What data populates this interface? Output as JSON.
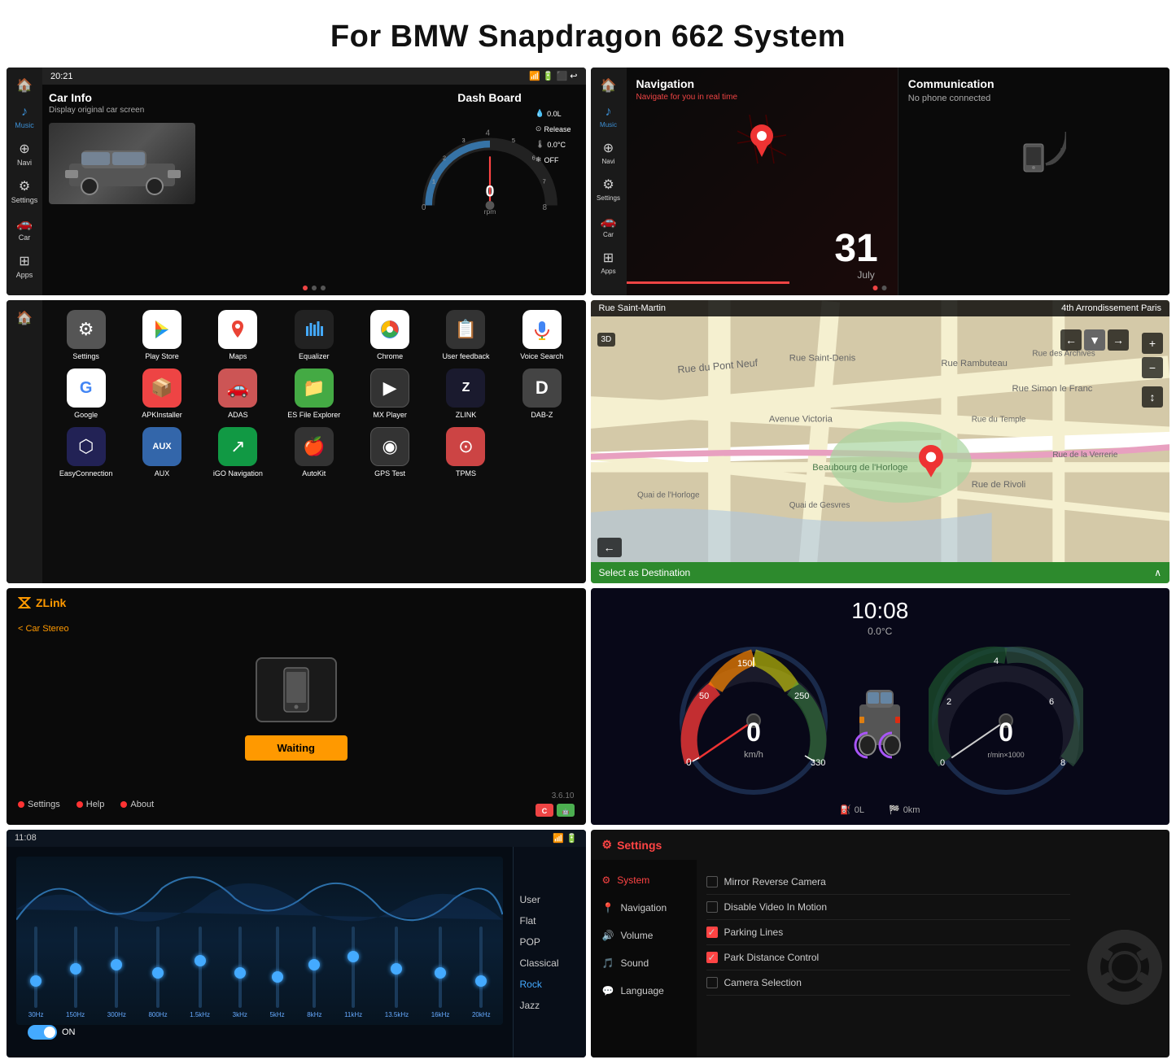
{
  "page": {
    "title": "For BMW Snapdragon 662 System"
  },
  "cell1": {
    "topbar": {
      "time": "20:21"
    },
    "carinfo_label": "Car Info",
    "carinfo_sub": "Display original car screen",
    "dashboard_label": "Dash Board",
    "rpm_label": "rpm",
    "readings": [
      "0.0L",
      "Release",
      "0.0°C",
      "OFF"
    ],
    "sidebar_items": [
      "♪",
      "≡",
      "⊕",
      "⚙",
      "🚗",
      "⊞"
    ],
    "sidebar_labels": [
      "Music",
      "Navi",
      "Settings",
      "Car",
      "Apps"
    ]
  },
  "cell2": {
    "nav_title": "Navigation",
    "nav_sub": "Navigate for you in real time",
    "comm_title": "Communication",
    "comm_sub": "No phone connected",
    "date_num": "31",
    "date_month": "July",
    "sidebar_items": [
      "♪",
      "≡",
      "⊕",
      "⚙",
      "🚗",
      "⊞"
    ],
    "sidebar_labels": [
      "Music",
      "Navi",
      "Settings",
      "Car",
      "Apps"
    ]
  },
  "cell3": {
    "apps": [
      {
        "label": "Settings",
        "icon": "⚙",
        "color": "#555"
      },
      {
        "label": "Play Store",
        "icon": "▶",
        "color": "#4CAF50"
      },
      {
        "label": "Maps",
        "icon": "📍",
        "color": "#fff"
      },
      {
        "label": "Equalizer",
        "icon": "≡",
        "color": "#222"
      },
      {
        "label": "Chrome",
        "icon": "◎",
        "color": "#fff"
      },
      {
        "label": "User feedback",
        "icon": "✉",
        "color": "#444"
      },
      {
        "label": "Voice Search",
        "icon": "🎤",
        "color": "#fff"
      },
      {
        "label": "Google",
        "icon": "G",
        "color": "#fff"
      },
      {
        "label": "APKInstaller",
        "icon": "📦",
        "color": "#e44"
      },
      {
        "label": "ADAS",
        "icon": "🚗",
        "color": "#c55"
      },
      {
        "label": "ES File Explorer",
        "icon": "📁",
        "color": "#4a4"
      },
      {
        "label": "MX Player",
        "icon": "▶",
        "color": "#333"
      },
      {
        "label": "ZLINK",
        "icon": "Z",
        "color": "#1a1a2e"
      },
      {
        "label": "DAB-Z",
        "icon": "D",
        "color": "#444"
      },
      {
        "label": "EasyConnection",
        "icon": "⬡",
        "color": "#225"
      },
      {
        "label": "AUX",
        "icon": "AUX",
        "color": "#36a"
      },
      {
        "label": "iGO Navigation",
        "icon": "↗",
        "color": "#194"
      },
      {
        "label": "AutoKit",
        "icon": "🍎",
        "color": "#333"
      },
      {
        "label": "GPS Test",
        "icon": "◎",
        "color": "#333"
      },
      {
        "label": "TPMS",
        "icon": "⊙",
        "color": "#c44"
      }
    ]
  },
  "cell4": {
    "street_label": "Rue Saint-Martin",
    "arrondissement": "4th Arrondissement Paris",
    "destination_label": "Select as Destination",
    "label_3d": "3D"
  },
  "cell5": {
    "app_name": "ZLink",
    "back_label": "< Car Stereo",
    "waiting_label": "Waiting",
    "settings_label": "Settings",
    "help_label": "Help",
    "about_label": "About",
    "version": "3.6.10"
  },
  "cell6": {
    "time": "10:08",
    "temp": "0.0°C",
    "speed": "0",
    "rpm_val": "0",
    "fuel_label": "0L",
    "km_label": "0km",
    "speed_unit": "km/h",
    "rpm_unit": "r/min×1000"
  },
  "cell7": {
    "time_bar": "11:08",
    "presets": [
      "User",
      "Flat",
      "POP",
      "Classical",
      "Rock",
      "Jazz"
    ],
    "active_preset": "Rock",
    "toggle_label": "ON",
    "freqs": [
      "30Hz",
      "150Hz",
      "300Hz",
      "800Hz",
      "1.5kHz",
      "3kHz",
      "5kHz",
      "8kHz",
      "11kHz",
      "13.5kHz",
      "16kHz",
      "20kHz"
    ]
  },
  "cell8": {
    "title": "Settings",
    "menu_items": [
      "System",
      "Navigation",
      "Volume",
      "Sound",
      "Language"
    ],
    "active_menu": "System",
    "options": [
      {
        "label": "Mirror Reverse Camera",
        "checked": false
      },
      {
        "label": "Disable Video In Motion",
        "checked": false
      },
      {
        "label": "Parking Lines",
        "checked": true
      },
      {
        "label": "Park Distance Control",
        "checked": true
      },
      {
        "label": "Camera Selection",
        "checked": false
      }
    ]
  }
}
